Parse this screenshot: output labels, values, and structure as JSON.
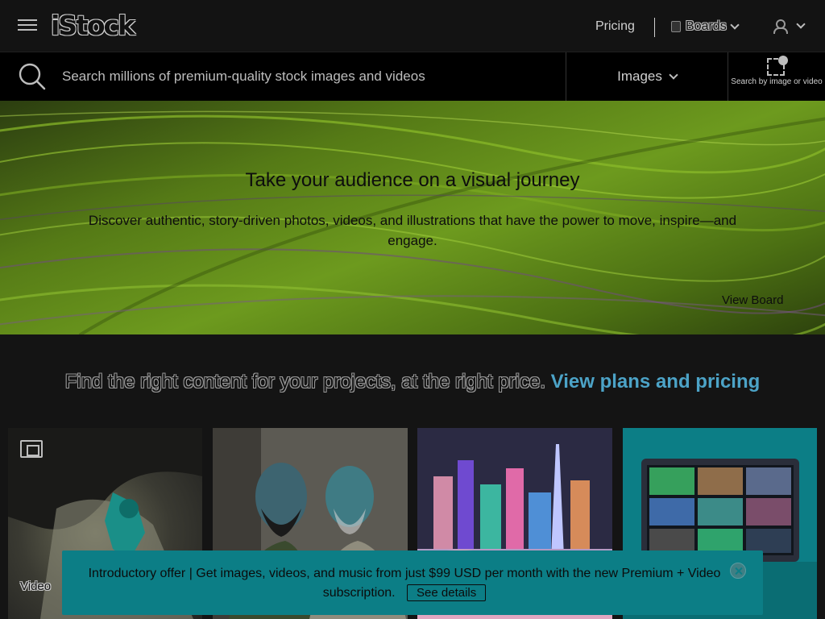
{
  "header": {
    "logo": "iStock",
    "pricing": "Pricing",
    "boards": "Boards"
  },
  "search": {
    "placeholder": "Search millions of premium-quality stock images and videos",
    "type": "Images",
    "visual_search_label": "Search by image or video"
  },
  "hero": {
    "title": "Take your audience on a visual journey",
    "subtitle": "Discover authentic, story-driven photos, videos, and illustrations that have the power to move, inspire—and engage.",
    "view_board": "View Board"
  },
  "find": {
    "text": "Find the right content for your projects, at the right price.",
    "link": "View plans and pricing"
  },
  "tiles": [
    {
      "label": "Video"
    }
  ],
  "promo": {
    "text": "Introductory offer | Get images, videos, and music from just $99 USD per month with the new Premium + Video subscription.",
    "button": "See details"
  },
  "colors": {
    "accent": "#0c7e86",
    "link": "#4ca3c7",
    "background": "#141414"
  }
}
